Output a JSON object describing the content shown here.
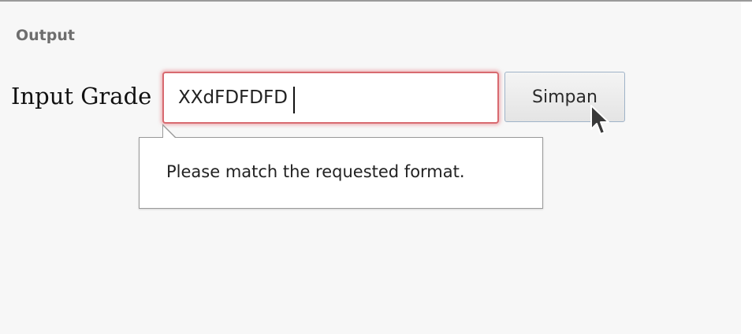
{
  "panel": {
    "title": "Output"
  },
  "form": {
    "label": "Input Grade",
    "input_value": "XXdFDFDFD",
    "button_label": "Simpan"
  },
  "validation": {
    "message": "Please match the requested format."
  },
  "icons": {
    "pointer": "mouse-pointer-icon"
  },
  "colors": {
    "invalid_border": "#d86a70",
    "button_border": "#9fb3c8"
  }
}
